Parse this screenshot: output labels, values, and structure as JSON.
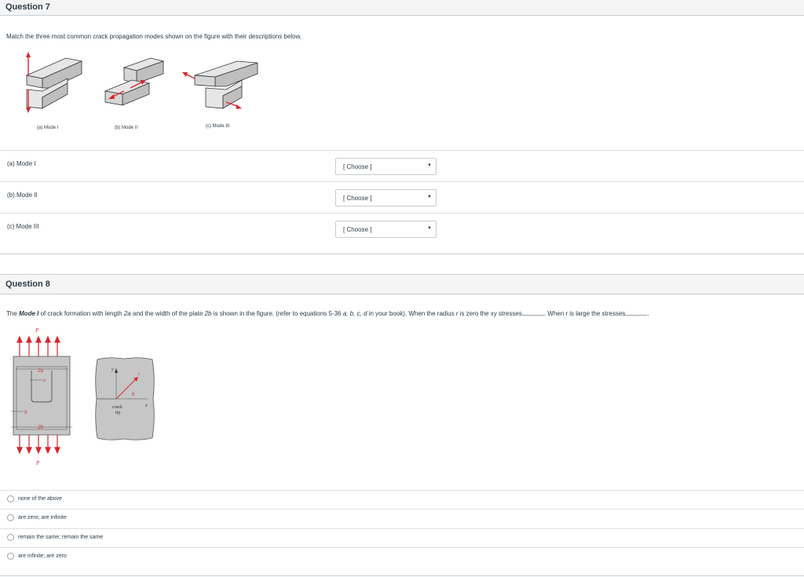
{
  "question7": {
    "title": "Question 7",
    "prompt": "Match the three most common crack propagation modes shown on the figure with their descriptions below.",
    "figure_captions": [
      "(a)  Mode I",
      "(b)  Mode II",
      "(c)  Mode III"
    ],
    "rows": [
      {
        "label": "(a) Mode I",
        "select_value": "[ Choose ]"
      },
      {
        "label": "(b) Mode II",
        "select_value": "[ Choose ]"
      },
      {
        "label": "(c) Mode III",
        "select_value": "[ Choose ]"
      }
    ]
  },
  "question8": {
    "title": "Question 8",
    "prompt_parts": {
      "p1": "The ",
      "mode_bold": "Mode I",
      "p2": " of crack formation with length ",
      "len": "2a",
      "p3": " and the width of the plate ",
      "width": "2b",
      "p4": " is shown in the figure. (refer to equations 5-36 ",
      "eqs": "a, b, c, d",
      "p5": " in your book).  When the radius ",
      "r": "r",
      "p6": " is zero the xy stresses",
      "p7": ". When r is large the stresses",
      "p8": "."
    },
    "figure_labels": {
      "P_top": "P",
      "P_bottom": "P",
      "two_a": "2a",
      "a": "a",
      "b": "b",
      "two_b": "2b",
      "y": "y",
      "r": "r",
      "theta": "θ",
      "x": "x",
      "crack": "crack",
      "tip": "tip"
    },
    "answers": [
      "none of the above",
      "are zero; are infinite",
      "remain the same; remain the same",
      "are infinite; are zero"
    ]
  },
  "colors": {
    "arrow_red": "#d9262c",
    "block_gray": "#bfbfbf",
    "panel_gray": "#c6c6c6"
  }
}
